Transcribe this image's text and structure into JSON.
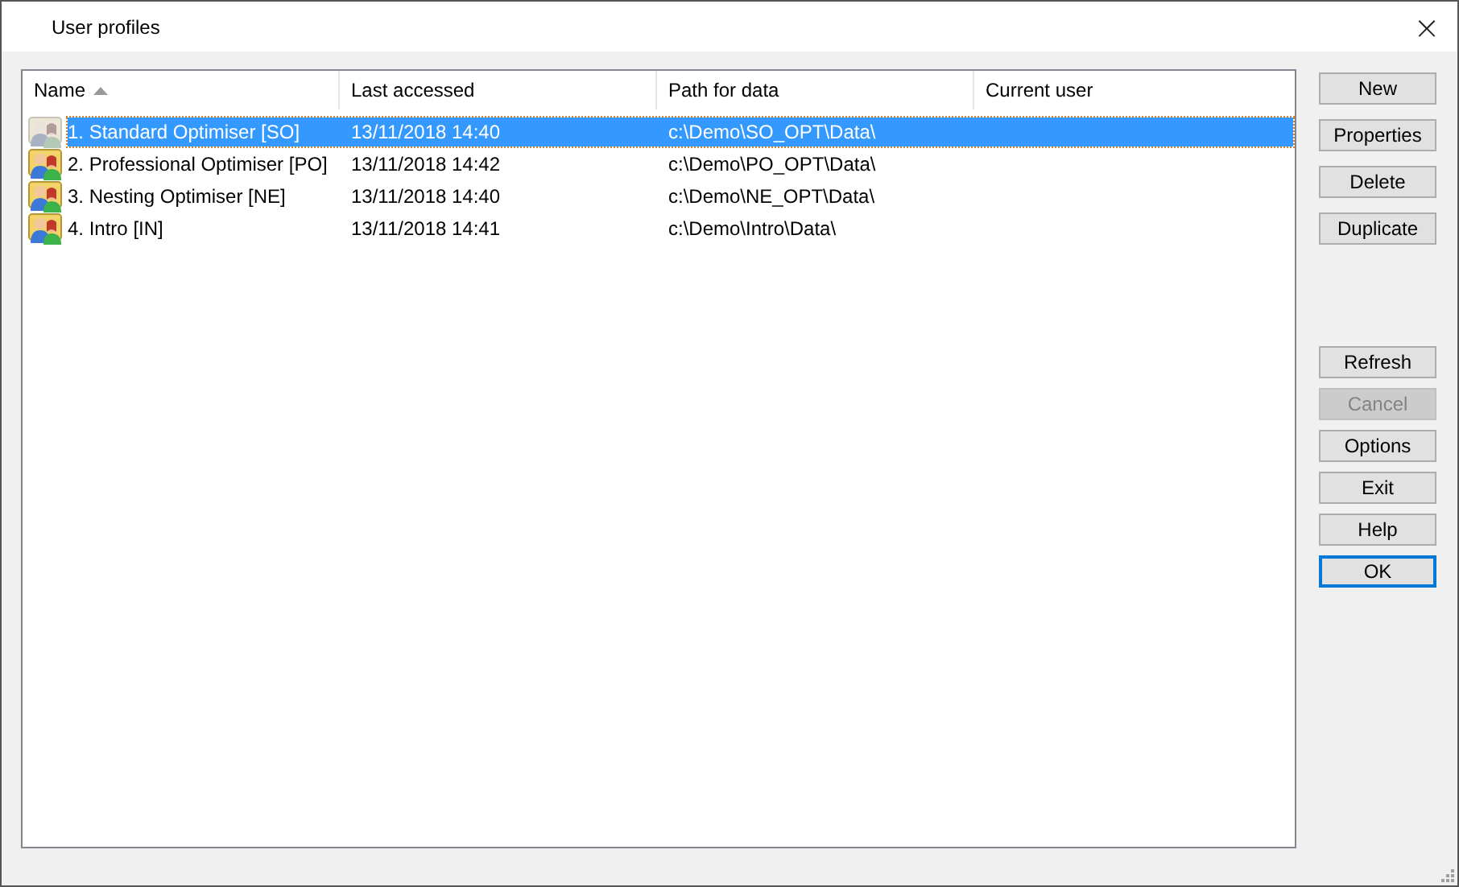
{
  "window": {
    "title": "User profiles",
    "close": "×"
  },
  "table": {
    "columns": [
      {
        "label": "Name",
        "sorted": true
      },
      {
        "label": "Last accessed",
        "sorted": false
      },
      {
        "label": "Path for data",
        "sorted": false
      },
      {
        "label": "Current user",
        "sorted": false
      }
    ],
    "rows": [
      {
        "name": "1. Standard Optimiser [SO]",
        "last_accessed": "13/11/2018 14:40",
        "path": "c:\\Demo\\SO_OPT\\Data\\",
        "selected": true
      },
      {
        "name": "2. Professional Optimiser [PO]",
        "last_accessed": "13/11/2018 14:42",
        "path": "c:\\Demo\\PO_OPT\\Data\\",
        "selected": false
      },
      {
        "name": "3. Nesting Optimiser [NE]",
        "last_accessed": "13/11/2018 14:40",
        "path": "c:\\Demo\\NE_OPT\\Data\\",
        "selected": false
      },
      {
        "name": "4. Intro [IN]",
        "last_accessed": "13/11/2018 14:41",
        "path": "c:\\Demo\\Intro\\Data\\",
        "selected": false
      }
    ]
  },
  "top_buttons": [
    {
      "label": "New",
      "disabled": false,
      "default": false
    },
    {
      "label": "Properties",
      "disabled": false,
      "default": false
    },
    {
      "label": "Delete",
      "disabled": false,
      "default": false
    },
    {
      "label": "Duplicate",
      "disabled": false,
      "default": false
    }
  ],
  "bottom_buttons": [
    {
      "label": "Refresh",
      "disabled": false,
      "default": false
    },
    {
      "label": "Cancel",
      "disabled": true,
      "default": false
    },
    {
      "label": "Options",
      "disabled": false,
      "default": false
    },
    {
      "label": "Exit",
      "disabled": false,
      "default": false
    },
    {
      "label": "Help",
      "disabled": false,
      "default": false
    },
    {
      "label": "OK",
      "disabled": false,
      "default": true
    }
  ]
}
